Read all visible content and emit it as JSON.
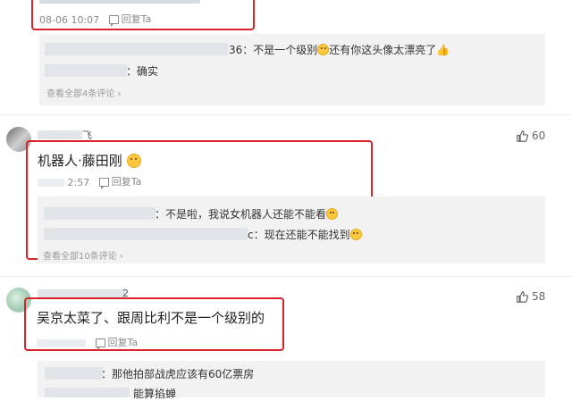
{
  "comment0": {
    "time": "08-06 10:07",
    "reply": "回复Ta",
    "sub_replies": [
      {
        "tail": "36：不是一个级别",
        "tail2": "还有你这头像太漂亮了"
      },
      {
        "tail": "：确实"
      }
    ],
    "view_all": "查看全部4条评论 ›"
  },
  "comment1": {
    "name_tail": "飞",
    "likes": "60",
    "text": "机器人·藤田刚",
    "time_tail": "2:57",
    "reply": "回复Ta",
    "sub_replies": [
      {
        "tail": "：不是啦，我说女机器人还能不能看"
      },
      {
        "tail": "c：现在还能不能找到"
      }
    ],
    "view_all": "查看全部10条评论 ›"
  },
  "comment2": {
    "name_tail": "2",
    "likes": "58",
    "text": "吴京太菜了、跟周比利不是一个级别的",
    "reply": "回复Ta",
    "sub_replies": [
      {
        "tail": "：那他拍部战虎应该有60亿票房"
      },
      {
        "tail": "能算掐蝉"
      }
    ]
  }
}
